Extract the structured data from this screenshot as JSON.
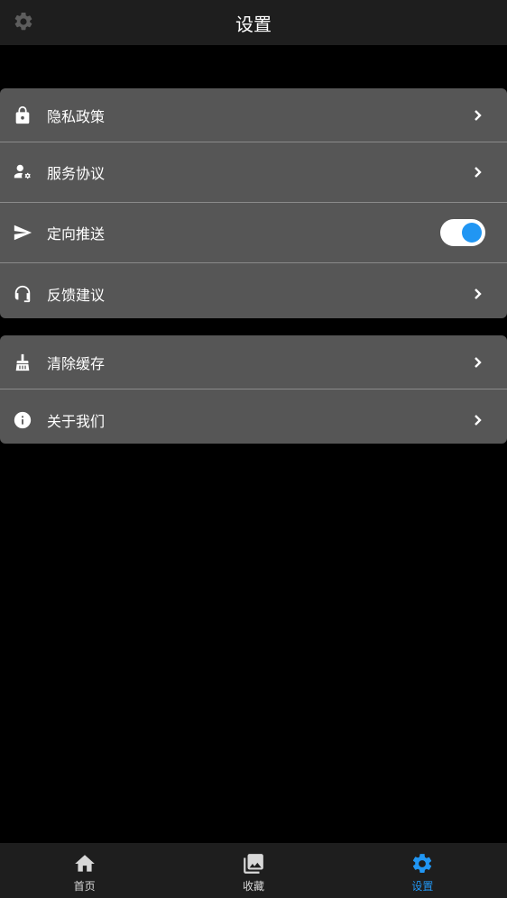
{
  "header": {
    "title": "设置",
    "corner_icon": "gear-icon"
  },
  "groups": [
    {
      "items": [
        {
          "label": "隐私政策",
          "icon": "lock-icon",
          "control": "chevron"
        },
        {
          "label": "服务协议",
          "icon": "user-gear-icon",
          "control": "chevron"
        },
        {
          "label": "定向推送",
          "icon": "send-icon",
          "control": "toggle",
          "toggle_on": true
        },
        {
          "label": "反馈建议",
          "icon": "headset-icon",
          "control": "chevron"
        }
      ]
    },
    {
      "items": [
        {
          "label": "清除缓存",
          "icon": "broom-icon",
          "control": "chevron"
        },
        {
          "label": "关于我们",
          "icon": "info-icon",
          "control": "chevron"
        }
      ]
    }
  ],
  "tabbar": {
    "tabs": [
      {
        "label": "首页",
        "icon": "home-icon",
        "active": false
      },
      {
        "label": "收藏",
        "icon": "gallery-icon",
        "active": false
      },
      {
        "label": "设置",
        "icon": "gear-icon",
        "active": true
      }
    ]
  },
  "colors": {
    "accent": "#2196f3",
    "row_bg": "#565656",
    "bar_bg": "#1e1e1e",
    "page_bg": "#000000"
  }
}
